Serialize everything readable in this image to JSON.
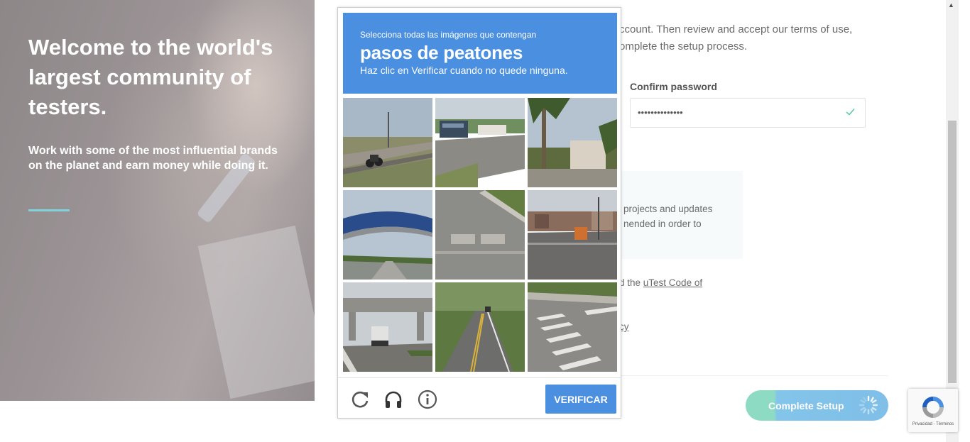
{
  "hero": {
    "title": "Welcome to the world's largest community of testers.",
    "subtitle": "Work with some of the most influential brands on the planet and earn money while doing it."
  },
  "form": {
    "intro_line1": "ccount. Then review and accept our terms of use,",
    "intro_line2": "omplete the setup process.",
    "confirm_label": "Confirm password",
    "confirm_value": "••••••••••••••",
    "pref_line1": "projects and updates",
    "pref_line2": "nended in order to",
    "code_prefix": "d the ",
    "code_link_1": "uTest Code of",
    "privacy_fragment": "cy",
    "complete_button": "Complete Setup"
  },
  "captcha": {
    "instruction_small": "Selecciona todas las imágenes que contengan",
    "target": "pasos de peatones",
    "hint": "Haz clic en Verificar cuando no quede ninguna.",
    "verify_button": "VERIFICAR",
    "footer_icons": [
      "reload-icon",
      "audio-icon",
      "info-icon"
    ],
    "tiles": [
      "motorcycle-road-tile",
      "gas-station-tile",
      "palm-trees-tile",
      "overpass-highway-tile",
      "crosswalk-closeup-tile",
      "intersection-truck-tile",
      "overpass-truck-tile",
      "wooded-road-tile",
      "crosswalk-stripes-tile"
    ]
  },
  "recaptcha_badge": {
    "terms": "Privacidad - Términos"
  },
  "colors": {
    "captcha_blue": "#4a8fe0",
    "accent_teal": "#7fd3dc",
    "button_green": "#8ddbc3",
    "button_blue": "#7fbfe8"
  }
}
